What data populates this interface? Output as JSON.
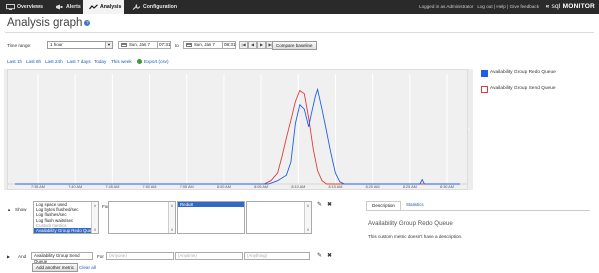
{
  "nav": {
    "tabs": [
      {
        "label": "Overviews",
        "icon": "monitor-icon"
      },
      {
        "label": "Alerts",
        "icon": "megaphone-icon"
      },
      {
        "label": "Analysis",
        "icon": "line-graph-icon",
        "active": true
      },
      {
        "label": "Configuration",
        "icon": "wrench-icon"
      }
    ],
    "logged_in_text": "Logged in as Administrator",
    "logout": "Log out",
    "help": "Help",
    "feedback": "Give feedback",
    "separator": "|",
    "brand_prefix": "sql",
    "brand_suffix": "MONITOR",
    "brand_mark": "«"
  },
  "page": {
    "title": "Analysis graph",
    "help_glyph": "?"
  },
  "time_range": {
    "label": "Time range:",
    "selected": "1 hour",
    "from_date": "Sun, Jan 7",
    "from_time": "07:31",
    "to_separator": "to",
    "to_date": "Sun, Jan 7",
    "to_time": "08:31",
    "compare_button": "Compare baseline",
    "pager_buttons": [
      "|◀",
      "◀",
      "▶",
      "▶|"
    ]
  },
  "quick_links": [
    "Last 1h",
    "Last 6h",
    "Last 24h",
    "Last 7 days",
    "Today",
    "This week"
  ],
  "export_label": "Export (csv)",
  "chart_data": {
    "type": "line",
    "x_ticks": [
      "7:35 AM",
      "7:40 AM",
      "7:45 AM",
      "7:50 AM",
      "7:55 AM",
      "8:00 AM",
      "8:05 AM",
      "8:10 AM",
      "8:15 AM",
      "8:20 AM",
      "8:25 AM",
      "8:30 AM"
    ],
    "grid": true,
    "series": [
      {
        "name": "Availability Group Redo Queue",
        "color": "#1f5fe6",
        "points": [
          [
            0,
            0
          ],
          [
            57,
            0
          ],
          [
            59,
            3
          ],
          [
            61,
            8
          ],
          [
            62,
            20
          ],
          [
            63,
            55
          ],
          [
            64,
            72
          ],
          [
            65,
            68
          ],
          [
            66,
            52
          ],
          [
            66.5,
            62
          ],
          [
            67.5,
            80
          ],
          [
            68,
            86
          ],
          [
            69,
            68
          ],
          [
            70,
            48
          ],
          [
            71,
            28
          ],
          [
            72,
            10
          ],
          [
            73,
            2
          ],
          [
            74,
            0
          ],
          [
            91,
            0
          ],
          [
            91.5,
            4
          ],
          [
            92,
            0
          ],
          [
            100,
            0
          ]
        ]
      },
      {
        "name": "Availability Group Send Queue",
        "color": "#e03c3c",
        "points": [
          [
            0,
            0
          ],
          [
            56,
            0
          ],
          [
            57.5,
            3
          ],
          [
            59,
            10
          ],
          [
            60,
            25
          ],
          [
            61,
            42
          ],
          [
            62,
            58
          ],
          [
            63,
            75
          ],
          [
            64,
            85
          ],
          [
            65,
            82
          ],
          [
            66,
            60
          ],
          [
            67,
            32
          ],
          [
            68,
            12
          ],
          [
            69,
            3
          ],
          [
            70,
            0
          ],
          [
            100,
            0
          ]
        ]
      }
    ]
  },
  "show_row": {
    "expand": "▲",
    "show_label": "Show",
    "for_label": "For",
    "metrics": [
      "Log space used",
      "Log bytes flushed/sec",
      "Log flushes/sec",
      "Log flush waits/sec"
    ],
    "custom_header": "Custom metrics",
    "custom_selected": "Availability Group Redo Queue",
    "targets": [
      "Redu8"
    ],
    "edit_icon": "✎",
    "remove_icon": "✖"
  },
  "and_row": {
    "expand": "▶",
    "and_label": "And",
    "metric_value": "Availability Group Send Queue",
    "for_label": "For",
    "for_placeholder_1": "(Anyone)",
    "for_placeholder_2": "(Anytime)",
    "for_placeholder_3": "(Anything)",
    "edit_icon": "✎",
    "remove_icon": "✖"
  },
  "actions": {
    "add": "Add another metric",
    "clear": "Clear all"
  },
  "description_panel": {
    "tab_description": "Description",
    "tab_statistics": "Statistics",
    "heading": "Availability Group Redo Queue",
    "text": "This custom metric doesn't have a description."
  }
}
